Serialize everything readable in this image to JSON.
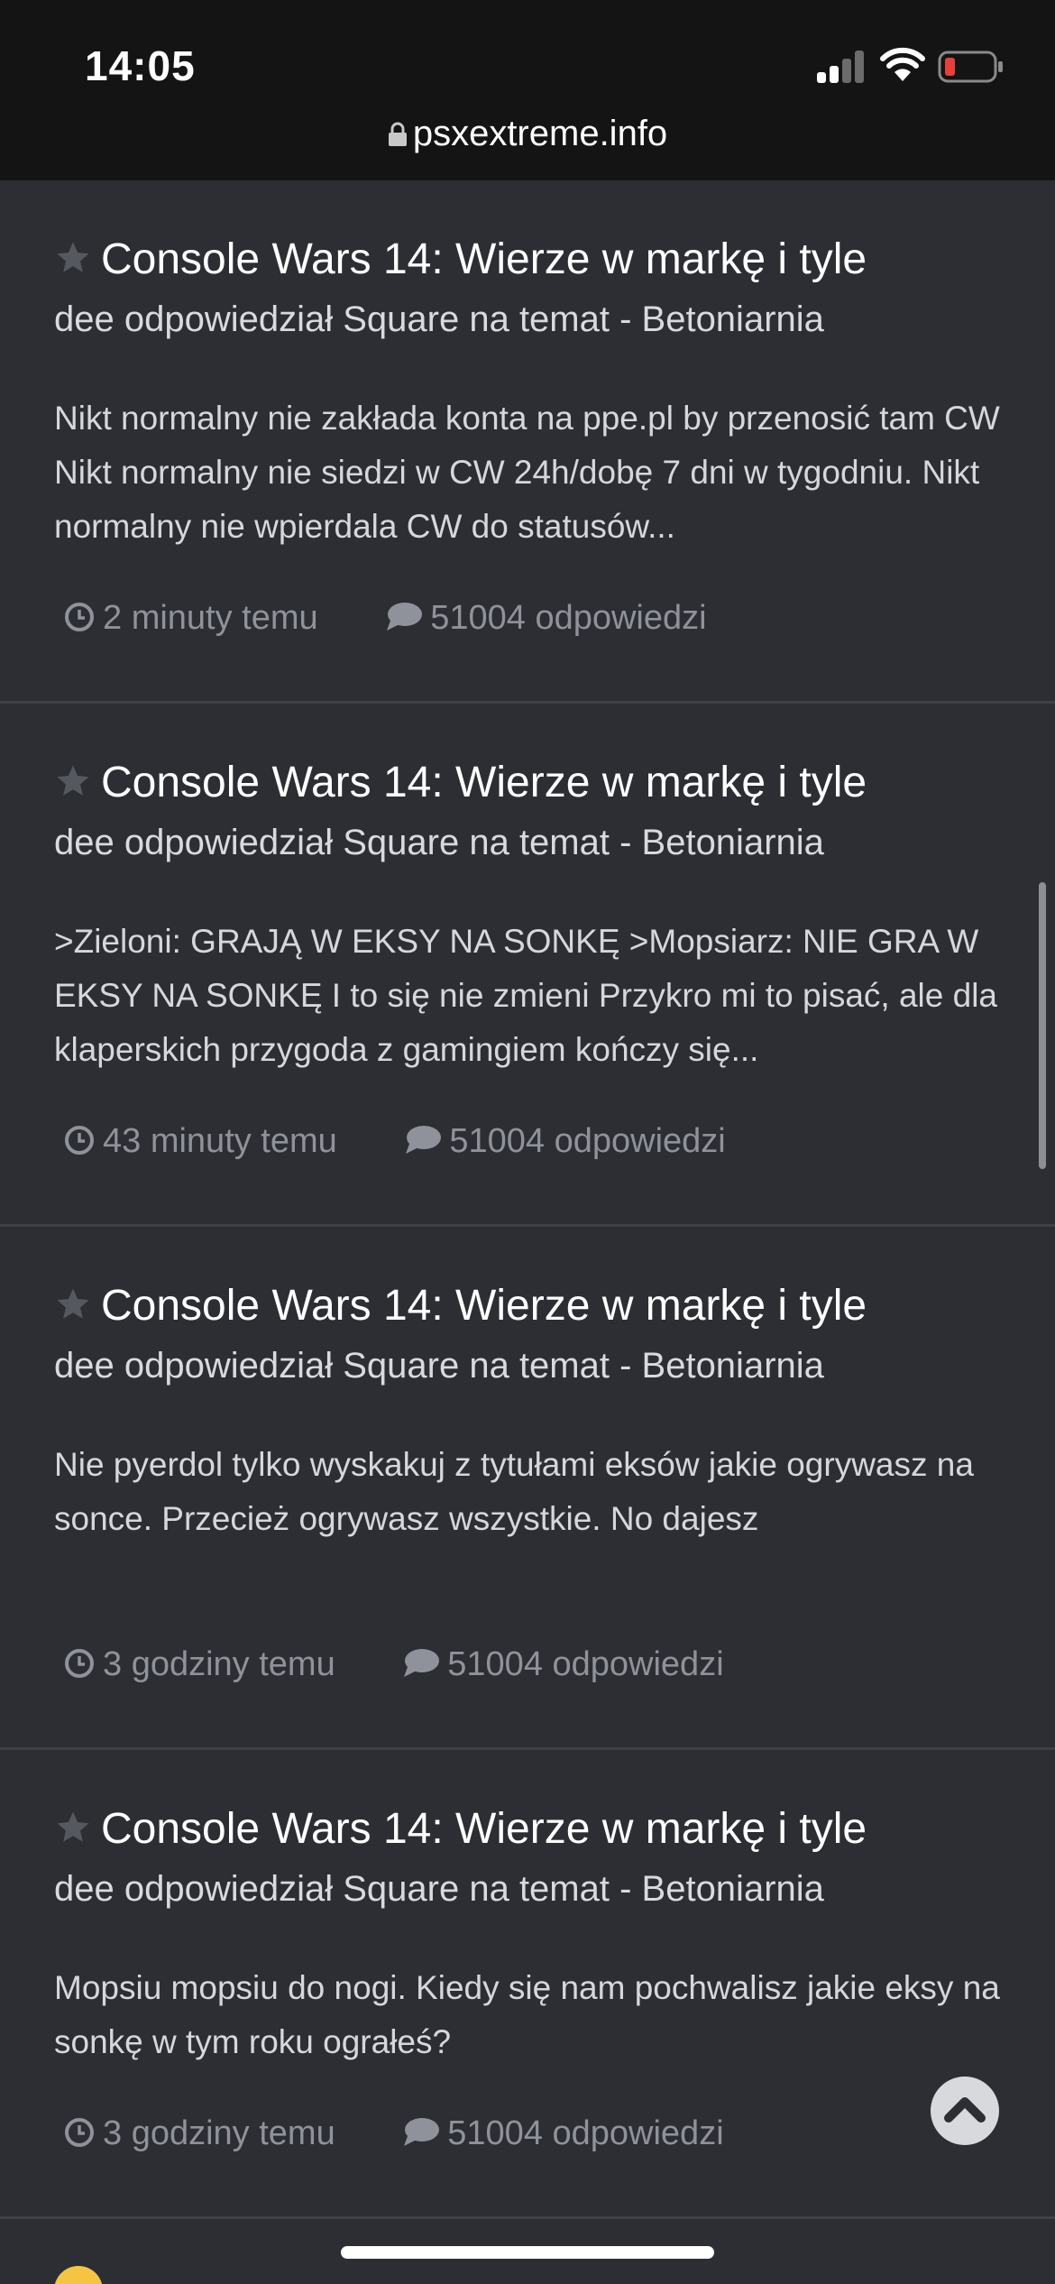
{
  "status_bar": {
    "time": "14:05"
  },
  "address_bar": {
    "url": "psxextreme.info"
  },
  "posts": [
    {
      "title": "Console Wars 14: Wierze w markę i tyle",
      "subtitle": "dee odpowiedział Square na temat - Betoniarnia",
      "excerpt": "Nikt normalny nie zakłada konta na ppe.pl by przenosić tam CW Nikt normalny nie siedzi w CW 24h/dobę 7 dni w tygodniu. Nikt normalny nie wpierdala CW do statusów...",
      "time": "2 minuty temu",
      "replies": "51004 odpowiedzi"
    },
    {
      "title": "Console Wars 14: Wierze w markę i tyle",
      "subtitle": "dee odpowiedział Square na temat - Betoniarnia",
      "excerpt": ">Zieloni: GRAJĄ W EKSY NA SONKĘ >Mopsiarz: NIE GRA W EKSY NA SONKĘ I to się nie zmieni Przykro mi to pisać, ale dla klaperskich przygoda z gamingiem kończy się...",
      "time": "43 minuty temu",
      "replies": "51004 odpowiedzi"
    },
    {
      "title": "Console Wars 14: Wierze w markę i tyle",
      "subtitle": "dee odpowiedział Square na temat - Betoniarnia",
      "excerpt": "Nie pyerdol tylko wyskakuj z tytułami eksów jakie ogrywasz na sonce. Przecież ogrywasz wszystkie. No dajesz",
      "time": "3 godziny temu",
      "replies": "51004 odpowiedzi"
    },
    {
      "title": "Console Wars 14: Wierze w markę i tyle",
      "subtitle": "dee odpowiedział Square na temat - Betoniarnia",
      "excerpt": "Mopsiu mopsiu do nogi. Kiedy się nam pochwalisz jakie eksy na sonkę w tym roku ograłeś?",
      "time": "3 godziny temu",
      "replies": "51004 odpowiedzi"
    }
  ],
  "colors": {
    "background": "#2c2e34",
    "topbar": "#141414",
    "battery_low": "#e5413a",
    "meta_text": "#8f929a"
  }
}
